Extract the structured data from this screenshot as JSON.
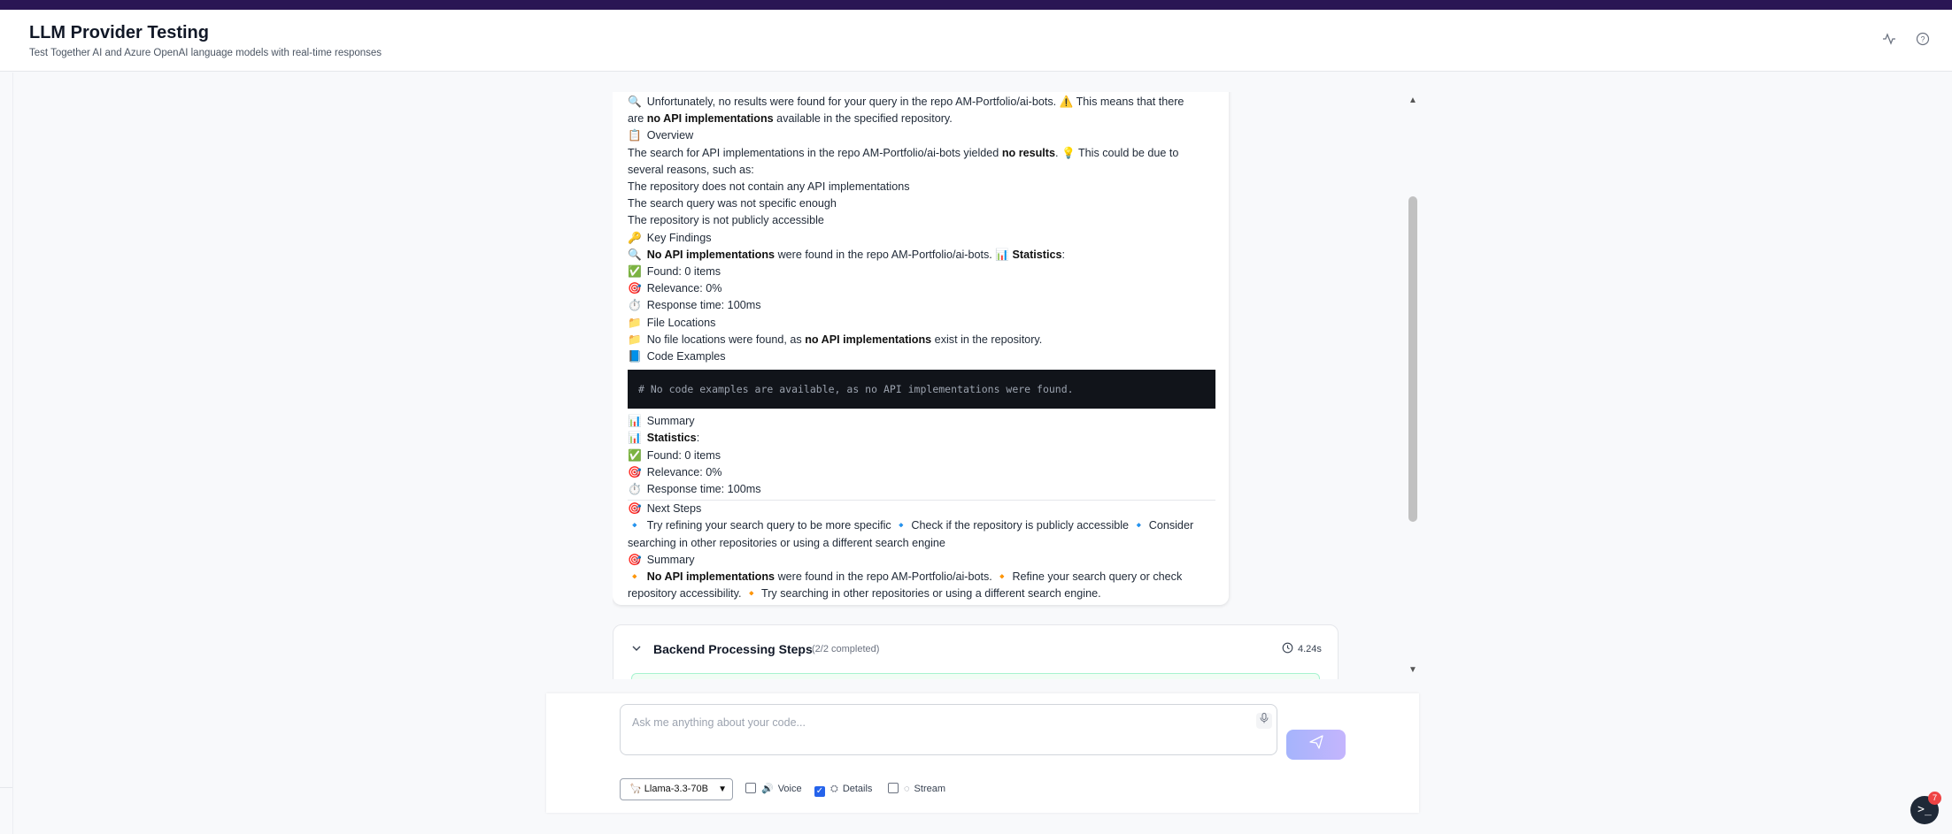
{
  "header": {
    "title": "LLM Provider Testing",
    "subtitle": "Test Together AI and Azure OpenAI language models with real-time responses",
    "icons": [
      "activity-icon",
      "help-icon"
    ]
  },
  "message": {
    "lines": [
      {
        "icon": "🔍",
        "parts": [
          {
            "t": "Unfortunately, no results were found for your query in the repo AM-Portfolio/ai-bots. ⚠️ This means that there"
          }
        ]
      },
      {
        "icon": "",
        "parts": [
          {
            "t": "are "
          },
          {
            "t": "no API implementations",
            "b": true
          },
          {
            "t": " available in the specified repository."
          }
        ]
      },
      {
        "icon": "📋",
        "parts": [
          {
            "t": "Overview"
          }
        ]
      },
      {
        "icon": "",
        "parts": [
          {
            "t": "The search for API implementations in the repo AM-Portfolio/ai-bots yielded "
          },
          {
            "t": "no results",
            "b": true
          },
          {
            "t": ". 💡 This could be due to"
          }
        ]
      },
      {
        "icon": "",
        "parts": [
          {
            "t": "several reasons, such as:"
          }
        ]
      },
      {
        "icon": "",
        "parts": [
          {
            "t": "The repository does not contain any API implementations"
          }
        ]
      },
      {
        "icon": "",
        "parts": [
          {
            "t": "The search query was not specific enough"
          }
        ]
      },
      {
        "icon": "",
        "parts": [
          {
            "t": "The repository is not publicly accessible"
          }
        ]
      },
      {
        "icon": "🔑",
        "parts": [
          {
            "t": "Key Findings"
          }
        ]
      },
      {
        "icon": "🔍",
        "parts": [
          {
            "t": "No API implementations",
            "b": true
          },
          {
            "t": " were found in the repo AM-Portfolio/ai-bots. 📊 "
          },
          {
            "t": "Statistics",
            "b": true
          },
          {
            "t": ":"
          }
        ]
      },
      {
        "icon": "✅",
        "parts": [
          {
            "t": "Found: 0 items"
          }
        ]
      },
      {
        "icon": "🎯",
        "parts": [
          {
            "t": "Relevance: 0%"
          }
        ]
      },
      {
        "icon": "⏱️",
        "parts": [
          {
            "t": "Response time: 100ms"
          }
        ]
      },
      {
        "icon": "📁",
        "parts": [
          {
            "t": "File Locations"
          }
        ]
      },
      {
        "icon": "📁",
        "parts": [
          {
            "t": "No file locations were found, as "
          },
          {
            "t": "no API implementations",
            "b": true
          },
          {
            "t": " exist in the repository."
          }
        ]
      },
      {
        "icon": "📘",
        "parts": [
          {
            "t": "Code Examples"
          }
        ]
      }
    ],
    "code": "# No code examples are available, as no API implementations were found.",
    "lines2": [
      {
        "icon": "📊",
        "parts": [
          {
            "t": "Summary"
          }
        ]
      },
      {
        "icon": "📊",
        "parts": [
          {
            "t": "Statistics",
            "b": true
          },
          {
            "t": ":"
          }
        ]
      },
      {
        "icon": "✅",
        "parts": [
          {
            "t": "Found: 0 items"
          }
        ]
      },
      {
        "icon": "🎯",
        "parts": [
          {
            "t": "Relevance: 0%"
          }
        ]
      },
      {
        "icon": "⏱️",
        "parts": [
          {
            "t": "Response time: 100ms"
          }
        ]
      }
    ],
    "lines3": [
      {
        "icon": "🎯",
        "parts": [
          {
            "t": "Next Steps"
          }
        ]
      },
      {
        "icon": "🔹",
        "parts": [
          {
            "t": "Try refining your search query to be more specific  🔹 Check if the repository is publicly accessible  🔹 Consider"
          }
        ]
      },
      {
        "icon": "",
        "parts": [
          {
            "t": "searching in other repositories or using a different search engine"
          }
        ]
      },
      {
        "icon": "🎯",
        "parts": [
          {
            "t": "Summary"
          }
        ]
      },
      {
        "icon": "🔸",
        "parts": [
          {
            "t": "No API implementations",
            "b": true
          },
          {
            "t": " were found in the repo AM-Portfolio/ai-bots.  🔸 Refine your search query or check"
          }
        ]
      },
      {
        "icon": "",
        "parts": [
          {
            "t": "repository accessibility.  🔸 Try searching in other repositories or using a different search engine."
          }
        ]
      }
    ]
  },
  "steps": {
    "title": "Backend Processing Steps",
    "count": "(2/2 completed)",
    "time": "4.24s"
  },
  "composer": {
    "placeholder": "Ask me anything about your code...",
    "model": "Llama-3.3-70B",
    "options": [
      {
        "label": "Voice",
        "checked": false,
        "icon": "🔊"
      },
      {
        "label": "Details",
        "checked": true,
        "icon": "⛭"
      },
      {
        "label": "Stream",
        "checked": false,
        "icon": "◌"
      }
    ]
  },
  "fab": {
    "badge": "7"
  }
}
